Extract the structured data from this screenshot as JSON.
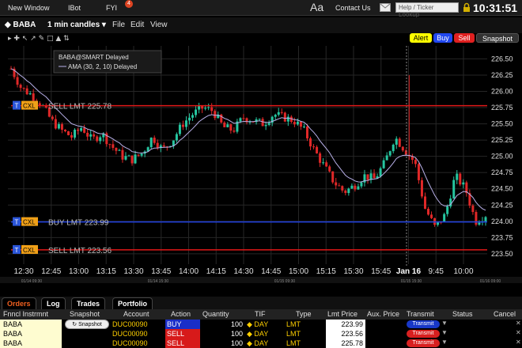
{
  "topbar": {
    "new_window": "New Window",
    "ibot": "IBot",
    "fyi": "FYI",
    "fyi_count": "4",
    "aa": "Aa",
    "contact": "Contact Us",
    "ticker_placeholder": "Help / Ticker Lookup",
    "clock": "10:31:51"
  },
  "chart_toolbar": {
    "symbol": "BABA",
    "period": "1 min candles",
    "menus": [
      "File",
      "Edit",
      "View"
    ],
    "alert": "Alert",
    "buy": "Buy",
    "sell": "Sell",
    "snapshot": "Snapshot"
  },
  "legend": {
    "title": "BABA@SMART Delayed",
    "ama": "AMA (30, 2, 10) Delayed"
  },
  "order_lines": [
    {
      "label": "SELL LMT 225.78",
      "price": 225.78,
      "color": "#e01818"
    },
    {
      "label": "BUY LMT 223.99",
      "price": 223.99,
      "color": "#2040e0"
    },
    {
      "label": "SELL LMT 223.56",
      "price": 223.56,
      "color": "#e01818"
    }
  ],
  "order_tag": {
    "t": "T",
    "cxl": "CXL"
  },
  "colors": {
    "up": "#26c6a0",
    "down": "#e02828",
    "ama": "#b8b0e8"
  },
  "chart_data": {
    "type": "candlestick",
    "y_ticks": [
      226.5,
      226.25,
      226.0,
      225.75,
      225.5,
      225.25,
      225.0,
      224.75,
      224.5,
      224.25,
      224.0,
      223.75,
      223.5
    ],
    "ylim": [
      223.34,
      226.7
    ],
    "x_ticks": [
      "12:30",
      "12:45",
      "13:00",
      "13:15",
      "13:30",
      "13:45",
      "14:00",
      "14:15",
      "14:30",
      "14:45",
      "15:00",
      "15:15",
      "15:30",
      "15:45",
      "Jan 16",
      "9:45",
      "10:00"
    ],
    "date_labels": [
      "01/14 09:30",
      "01/14 15:30",
      "01/15 09:30",
      "01/15 15:30",
      "01/16 09:00"
    ],
    "close_path": [
      226.35,
      226.05,
      225.95,
      225.8,
      225.55,
      225.4,
      225.3,
      225.45,
      225.25,
      225.35,
      225.15,
      225.0,
      224.95,
      225.05,
      225.3,
      225.1,
      225.25,
      225.5,
      225.65,
      225.75,
      225.7,
      225.45,
      225.4,
      225.6,
      225.55,
      225.5,
      225.65,
      225.6,
      225.55,
      225.4,
      225.1,
      224.85,
      224.6,
      224.45,
      224.55,
      224.7,
      224.65,
      224.9,
      225.3,
      225.1,
      224.9,
      224.2,
      223.9,
      224.1,
      224.7,
      224.5,
      224.0,
      224.1
    ]
  },
  "tabs": [
    "Orders",
    "Log",
    "Trades",
    "Portfolio"
  ],
  "table": {
    "headers": [
      "Fnncl Instrmnt",
      "Snapshot",
      "Account",
      "Action",
      "Quantity",
      "TIF",
      "Type",
      "Lmt Price",
      "Aux. Price",
      "Transmit",
      "Status",
      "Cancel"
    ],
    "rows": [
      {
        "instrument": "BABA",
        "snapshot": "Snapshot",
        "account": "DUC00090",
        "action": "BUY",
        "quantity": "100",
        "tif": "DAY",
        "type": "LMT",
        "lmt_price": "223.99",
        "transmit": "Transmit"
      },
      {
        "instrument": "BABA",
        "snapshot": "",
        "account": "DUC00090",
        "action": "SELL",
        "quantity": "100",
        "tif": "DAY",
        "type": "LMT",
        "lmt_price": "223.56",
        "transmit": "Transmit"
      },
      {
        "instrument": "BABA",
        "snapshot": "",
        "account": "DUC00090",
        "action": "SELL",
        "quantity": "100",
        "tif": "DAY",
        "type": "LMT",
        "lmt_price": "225.78",
        "transmit": "Transmit"
      }
    ]
  }
}
